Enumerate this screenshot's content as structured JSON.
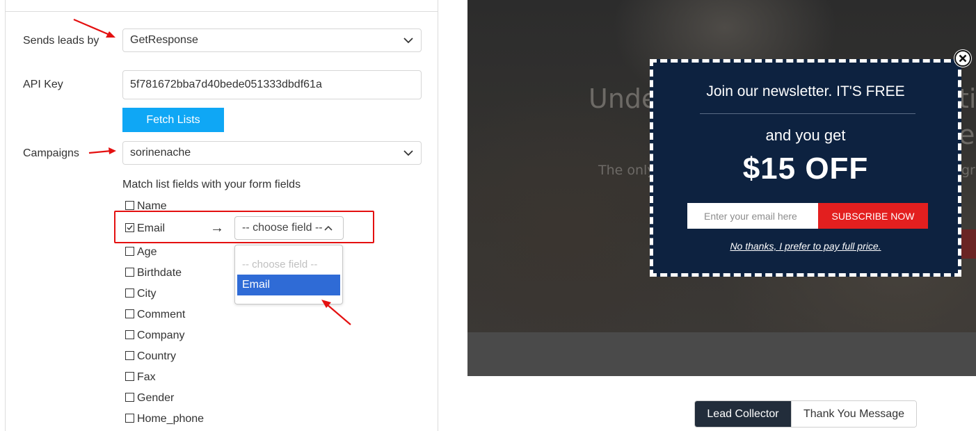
{
  "settings": {
    "sends_leads_by": {
      "label": "Sends leads by",
      "value": "GetResponse"
    },
    "api_key": {
      "label": "API Key",
      "value": "5f781672bba7d40bede051333dbdf61a"
    },
    "fetch_button": "Fetch Lists",
    "campaigns": {
      "label": "Campaigns",
      "value": "sorinenache"
    },
    "match_title": "Match list fields with your form fields",
    "fields": [
      {
        "label": "Name",
        "checked": false
      },
      {
        "label": "Email",
        "checked": true
      },
      {
        "label": "Age",
        "checked": false
      },
      {
        "label": "Birthdate",
        "checked": false
      },
      {
        "label": "City",
        "checked": false
      },
      {
        "label": "Comment",
        "checked": false
      },
      {
        "label": "Company",
        "checked": false
      },
      {
        "label": "Country",
        "checked": false
      },
      {
        "label": "Fax",
        "checked": false
      },
      {
        "label": "Gender",
        "checked": false
      },
      {
        "label": "Home_phone",
        "checked": false
      }
    ],
    "mapping_arrow": "→",
    "choose_field": {
      "value": "-- choose field --",
      "options": [
        "-- choose field --",
        "Email"
      ]
    }
  },
  "preview": {
    "background_fragments": [
      "Unde",
      "ti",
      "The only",
      "gr",
      "e",
      "c"
    ],
    "popup": {
      "title": "Join our newsletter. IT'S FREE",
      "subtitle": "and you get",
      "offer": "$15 OFF",
      "email_placeholder": "Enter your email here",
      "subscribe_button": "SUBSCRIBE NOW",
      "decline_link": "No thanks, I prefer to pay full price."
    }
  },
  "tabs": [
    {
      "label": "Lead Collector",
      "active": true
    },
    {
      "label": "Thank You Message",
      "active": false
    }
  ],
  "colors": {
    "accent_blue": "#0fa7f5",
    "highlight_red": "#e41010",
    "popup_bg": "#0d2240",
    "subscribe_red": "#e31f1f",
    "selected_option": "#2f6bd6",
    "active_tab": "#222d3b"
  },
  "icons": {
    "select_chevron": "chevron-down-icon",
    "open_chevron": "chevron-up-icon",
    "popup_close": "close-circle-icon"
  }
}
